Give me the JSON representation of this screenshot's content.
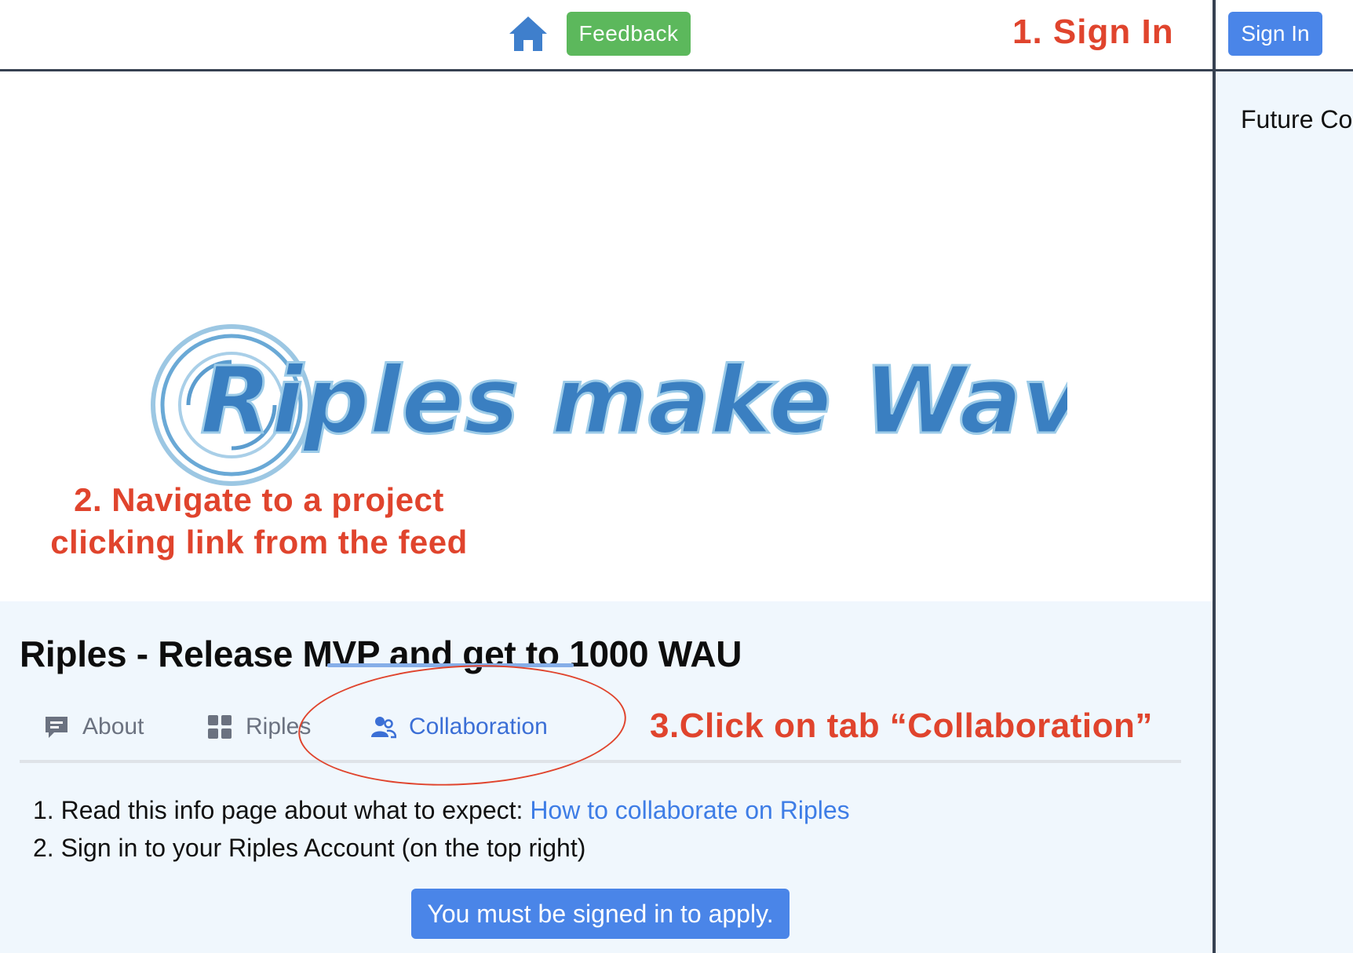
{
  "header": {
    "feedback_label": "Feedback",
    "signin_label": "Sign In"
  },
  "annotations": {
    "step1": "1. Sign In",
    "step2": "2. Navigate to a project clicking link from the feed",
    "step3": "3.Click on tab “Collaboration”"
  },
  "right_panel": {
    "text": "Future Co"
  },
  "hero": {
    "logo_text": "Riples make Waves"
  },
  "project": {
    "title": "Riples - Release MVP and get to 1000 WAU",
    "tabs": [
      {
        "label": "About",
        "icon": "chat-icon"
      },
      {
        "label": "Riples",
        "icon": "grid-icon"
      },
      {
        "label": "Collaboration",
        "icon": "users-icon",
        "active": true
      }
    ],
    "steps": {
      "step1_prefix": "1. Read this info page about what to expect: ",
      "step1_link": "How to collaborate on Riples",
      "step2": "2. Sign in to your Riples Account (on the top right)"
    },
    "apply_label": "You must be signed in to apply."
  },
  "colors": {
    "annotation": "#e0442d",
    "primary": "#4a85e8",
    "feedback": "#5cb85c",
    "active_tab": "#3b6fd6",
    "link": "#3e7de6",
    "project_bg": "#f0f7fd"
  }
}
